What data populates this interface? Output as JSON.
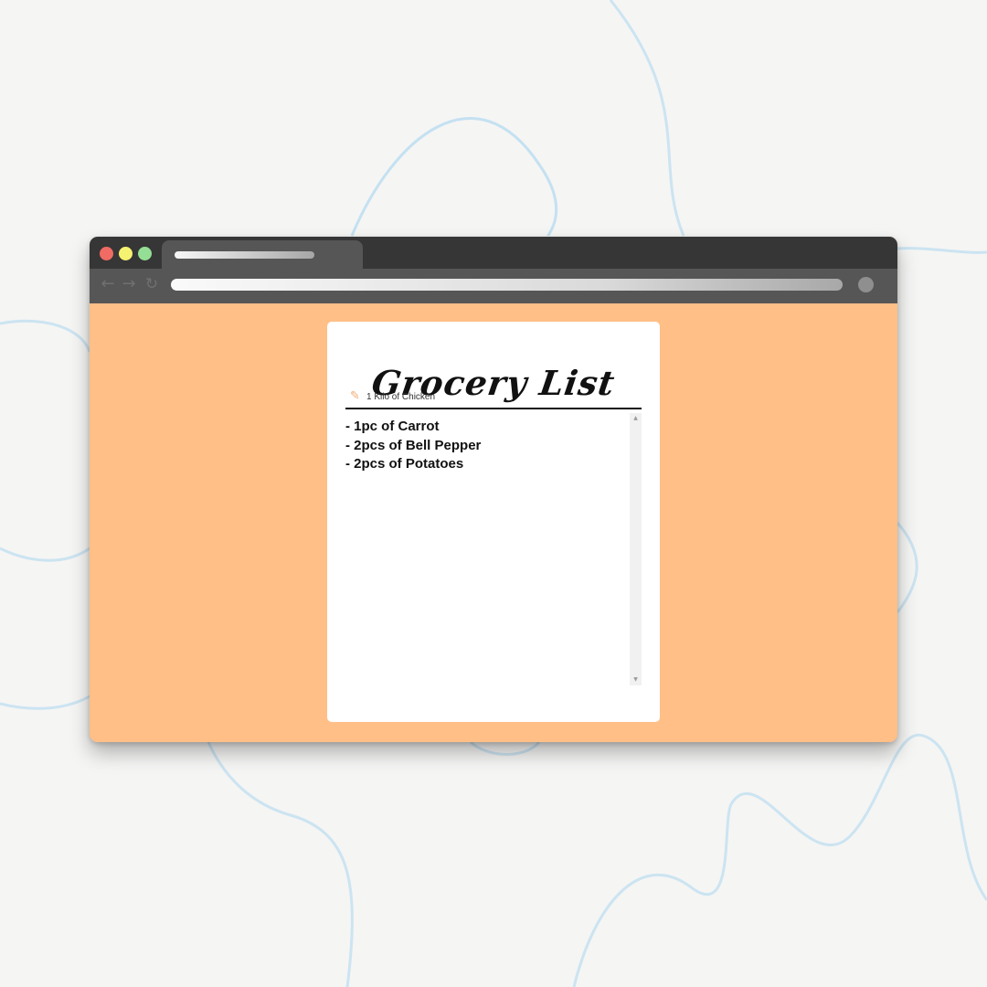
{
  "app": {
    "title": "Grocery List",
    "input": {
      "value": "1 Kilo of Chicken",
      "placeholder": ""
    },
    "items": [
      "- 1pc of Carrot",
      "- 2pcs of Bell Pepper",
      "- 2pcs of Potatoes"
    ]
  },
  "browser": {
    "nav_icons": {
      "back": "←",
      "forward": "→",
      "reload": "↻"
    },
    "window_controls": [
      "close-dot",
      "minimize-dot",
      "maximize-dot"
    ]
  },
  "icons": {
    "pencil": "✎",
    "scroll_up": "▲",
    "scroll_down": "▼"
  },
  "colors": {
    "background": "#f5f5f4",
    "squiggle": "#a9d6ef",
    "browser_chrome": "#363636",
    "toolbar": "#565656",
    "viewport": "#ffbf87",
    "card": "#ffffff",
    "pencil": "#f3aa72",
    "close": "#f06b64",
    "minimize": "#f6f271",
    "maximize": "#95de95"
  }
}
